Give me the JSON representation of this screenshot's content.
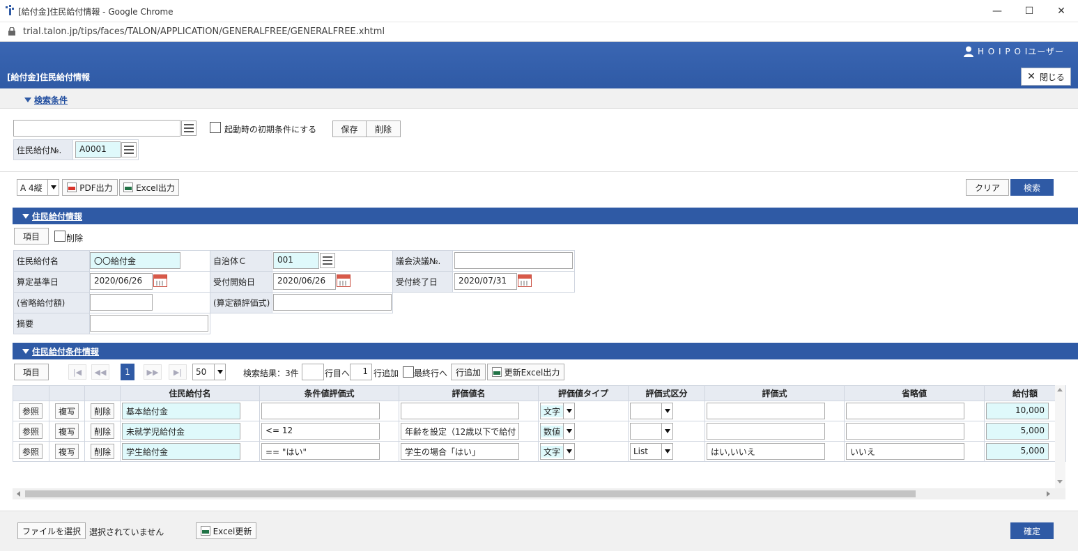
{
  "window": {
    "title": "[給付金]住民給付情報 - Google Chrome",
    "url": "trial.talon.jp/tips/faces/TALON/APPLICATION/GENERALFREE/GENERALFREE.xhtml",
    "minimize": "—",
    "maximize": "☐",
    "close": "✕"
  },
  "header": {
    "user": "H O I P O Iユーザー",
    "page_title": "[給付金]住民給付情報",
    "close_label": "閉じる"
  },
  "search": {
    "section_label": "検索条件",
    "preset_value": "",
    "initial_cond_label": "起動時の初期条件にする",
    "save_label": "保存",
    "delete_label": "削除",
    "field_label": "住民給付№.",
    "field_value": "A0001"
  },
  "toolbar": {
    "paper": "A 4縦",
    "pdf_label": "PDF出力",
    "excel_label": "Excel出力",
    "clear_label": "クリア",
    "search_label": "検索"
  },
  "info": {
    "section_label": "住民給付情報",
    "item_label": "項目",
    "delete_label": "削除",
    "fields": {
      "name_label": "住民給付名",
      "name_value": "〇〇給付金",
      "muni_label": "自治体Ｃ",
      "muni_value": "001",
      "council_label": "議会決議№.",
      "council_value": "",
      "base_label": "算定基準日",
      "base_value": "2020/06/26",
      "start_label": "受付開始日",
      "start_value": "2020/06/26",
      "end_label": "受付終了日",
      "end_value": "2020/07/31",
      "amount_label": "(省略給付額)",
      "amount_value": "",
      "formula_label": "(算定額評価式)",
      "formula_value": "",
      "note_label": "摘要",
      "note_value": ""
    }
  },
  "conditions": {
    "section_label": "住民給付条件情報",
    "item_label": "項目",
    "page": "1",
    "page_size": "50",
    "result_text": "検索結果：3件",
    "goto_value": "",
    "goto_label": "行目へ",
    "add_count": "1",
    "add_label": "行追加",
    "last_row_label": "最終行へ",
    "add_row_label": "行追加",
    "update_excel_label": "更新Excel出力",
    "columns": [
      "住民給付名",
      "条件値評価式",
      "評価値名",
      "評価値タイプ",
      "評価式区分",
      "評価式",
      "省略値",
      "給付額"
    ],
    "row_buttons": {
      "ref": "参照",
      "copy": "複写",
      "del": "削除"
    },
    "rows": [
      {
        "name": "基本給付金",
        "cond": "",
        "eval_name": "",
        "type": "文字",
        "kubun": "",
        "formula": "",
        "default": "",
        "amount": "10,000"
      },
      {
        "name": "未就学児給付金",
        "cond": "<= 12",
        "eval_name": "年齢を設定（12歳以下で給付",
        "type": "数値",
        "kubun": "",
        "formula": "",
        "default": "",
        "amount": "5,000"
      },
      {
        "name": "学生給付金",
        "cond": "== \"はい\"",
        "eval_name": "学生の場合「はい」",
        "type": "文字",
        "kubun": "List",
        "formula": "はい,いいえ",
        "default": "いいえ",
        "amount": "5,000"
      }
    ]
  },
  "footer": {
    "file_button": "ファイルを選択",
    "file_status": "選択されていません",
    "excel_update_label": "Excel更新",
    "confirm_label": "確定"
  },
  "colors": {
    "header_blue": "#2f5aa5",
    "input_cyan": "#dff9fb",
    "label_gray": "#e7ebf2"
  }
}
